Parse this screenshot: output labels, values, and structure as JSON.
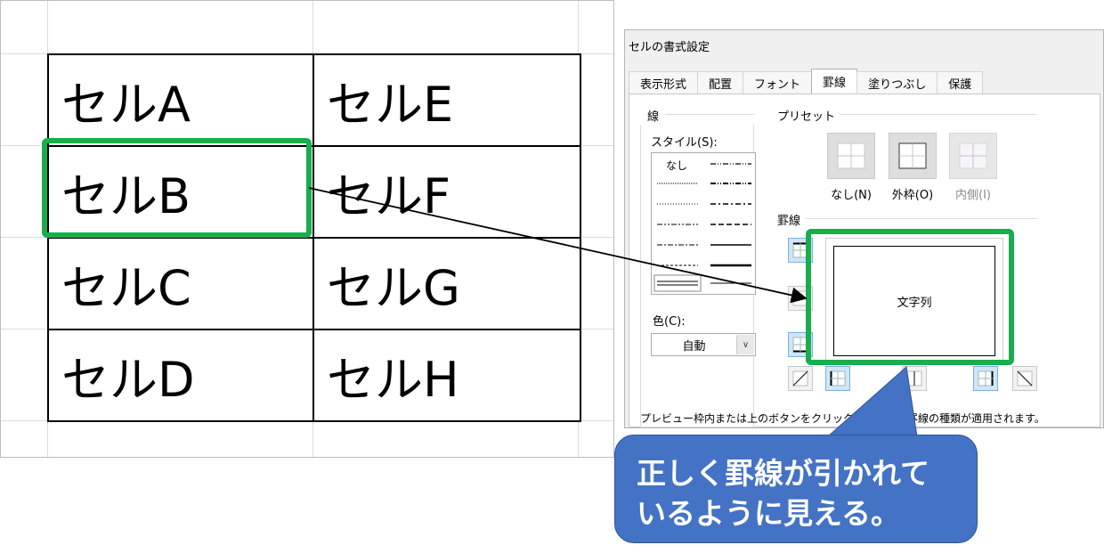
{
  "sheet": {
    "rows": [
      [
        "セルA",
        "セルE"
      ],
      [
        "セルB",
        "セルF"
      ],
      [
        "セルC",
        "セルG"
      ],
      [
        "セルD",
        "セルH"
      ]
    ]
  },
  "dialog": {
    "title": "セルの書式設定",
    "tabs": [
      "表示形式",
      "配置",
      "フォント",
      "罫線",
      "塗りつぶし",
      "保護"
    ],
    "active_tab": "罫線",
    "line_group": "線",
    "style_label": "スタイル(S):",
    "style_none": "なし",
    "color_label": "色(C):",
    "color_value": "自動",
    "preset_group": "プリセット",
    "presets": [
      "なし(N)",
      "外枠(O)",
      "内側(I)"
    ],
    "border_group": "罫線",
    "preview_text": "文字列",
    "hint_left": "プレビュー枠内または上のボタンをクリックす",
    "hint_right": "罫線の種類が適用されます。"
  },
  "callout": {
    "line1": "正しく罫線が引かれて",
    "line2": "いるように見える。"
  },
  "colors": {
    "highlight": "#19ad4e",
    "callout": "#4472c4",
    "selected_button": "#cfe6f8"
  }
}
